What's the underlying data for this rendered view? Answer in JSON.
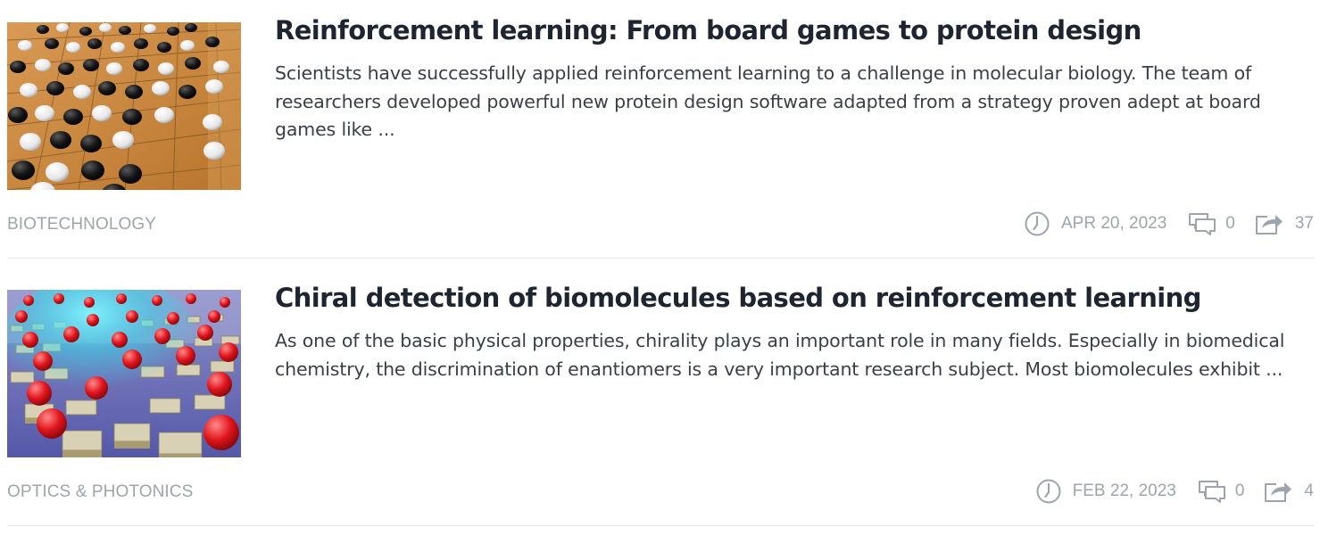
{
  "articles": [
    {
      "title": "Reinforcement learning: From board games to protein design",
      "summary": "Scientists have successfully applied reinforcement learning to a challenge in molecular biology. The team of researchers developed powerful new protein design software adapted from a strategy proven adept at board games like ...",
      "category": "BIOTECHNOLOGY",
      "date": "APR 20, 2023",
      "comments": "0",
      "shares": "37",
      "thumbnail": "go-board-with-black-and-white-stones"
    },
    {
      "title": "Chiral detection of biomolecules based on reinforcement learning",
      "summary": "As one of the basic physical properties, chirality plays an important role in many fields. Especially in biomedical chemistry, the discrimination of enantiomers is a very important research subject. Most biomolecules exhibit ...",
      "category": "OPTICS & PHOTONICS",
      "date": "FEB 22, 2023",
      "comments": "0",
      "shares": "4",
      "thumbnail": "nanostructure-array-with-red-molecules-and-cyan-light"
    }
  ],
  "icons": {
    "date": "clock-icon",
    "comments": "comment-bubble-icon",
    "shares": "share-arrow-icon"
  },
  "colors": {
    "title": "#1e2430",
    "body": "#3a3f47",
    "meta": "#9ea4ae",
    "divider": "#e3e5e8"
  }
}
